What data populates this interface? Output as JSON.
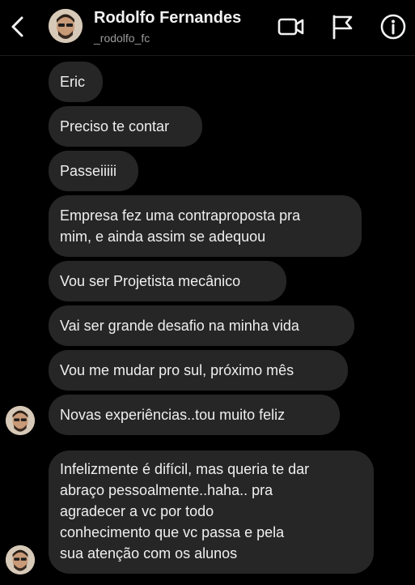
{
  "header": {
    "name": "Rodolfo Fernandes",
    "username": "_rodolfo_fc"
  },
  "messages": [
    {
      "text": "Eric"
    },
    {
      "text": "Preciso te contar"
    },
    {
      "text": "Passeiiiii"
    },
    {
      "lines": [
        "Empresa fez uma contraproposta pra",
        "mim, e ainda assim se adequou"
      ]
    },
    {
      "text": "Vou ser Projetista mecânico"
    },
    {
      "text": "Vai ser grande desafio na minha vida"
    },
    {
      "text": "Vou me mudar pro sul, próximo mês"
    },
    {
      "text": "Novas experiências..tou muito feliz"
    },
    {
      "lines": [
        "Infelizmente é difícil, mas queria te dar",
        "abraço pessoalmente..haha.. pra",
        "agradecer a vc por todo",
        "conhecimento que vc passa e pela",
        "sua atenção com os alunos"
      ]
    }
  ],
  "colors": {
    "background": "#000000",
    "bubble": "#262626",
    "text": "#efefef",
    "subtext": "#9a9a9a"
  },
  "icons": {
    "back": "chevron-left-icon",
    "video": "video-camera-icon",
    "flag": "flag-icon",
    "info": "info-circle-icon"
  }
}
